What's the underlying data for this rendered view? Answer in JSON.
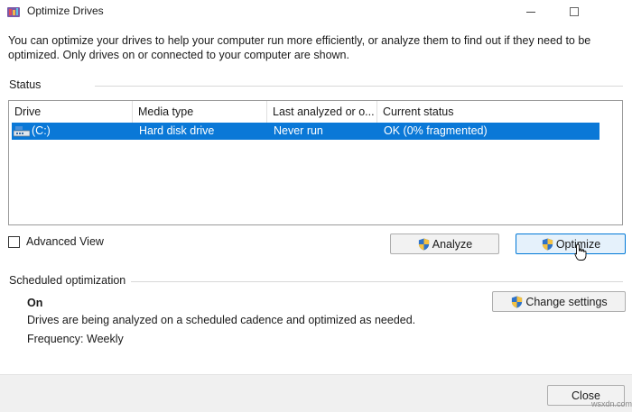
{
  "window": {
    "title": "Optimize Drives",
    "minimize_symbol": "—",
    "maximize_symbol": "☐"
  },
  "description": "You can optimize your drives to help your computer run more efficiently, or analyze them to find out if they need to be optimized. Only drives on or connected to your computer are shown.",
  "status": {
    "label": "Status",
    "columns": [
      "Drive",
      "Media type",
      "Last analyzed or o...",
      "Current status"
    ],
    "rows": [
      {
        "drive": "(C:)",
        "media_type": "Hard disk drive",
        "last_analyzed": "Never run",
        "current_status": "OK (0% fragmented)",
        "selected": true,
        "icon": "drive-icon"
      }
    ]
  },
  "advanced_view": {
    "label": "Advanced View",
    "checked": false
  },
  "buttons": {
    "analyze": "Analyze",
    "optimize": "Optimize",
    "change_settings": "Change settings",
    "close": "Close"
  },
  "scheduled": {
    "label": "Scheduled optimization",
    "state": "On",
    "description": "Drives are being analyzed on a scheduled cadence and optimized as needed.",
    "frequency": "Frequency: Weekly"
  },
  "watermark": "wsxdn.com",
  "colors": {
    "selection": "#0a78d7",
    "selection_text": "#ffffff",
    "footer_bg": "#f0f0f0",
    "button_bg": "#f2f2f2",
    "focused_button_bg": "#e5f1fb",
    "focused_button_border": "#0078d7"
  }
}
